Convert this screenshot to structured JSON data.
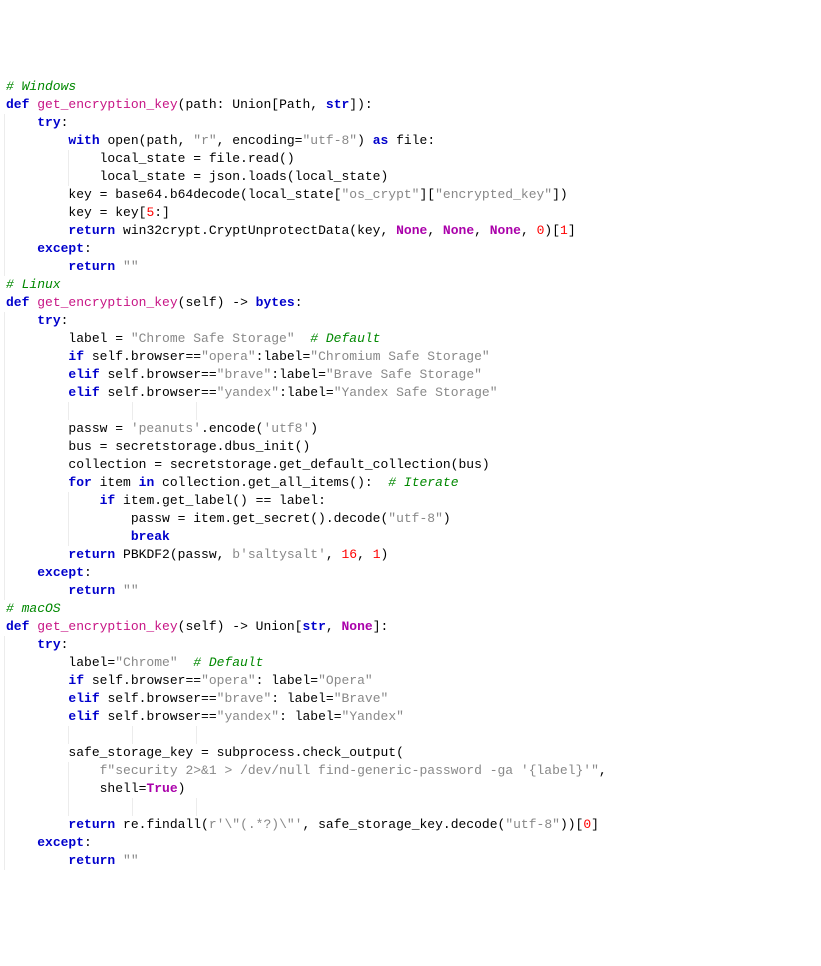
{
  "indentGuideColumns": [
    1,
    9,
    17,
    25
  ],
  "indentUnit": 4,
  "colors": {
    "keyword": "#0000cc",
    "funcName": "#c71585",
    "string": "#888888",
    "number": "#ff0000",
    "comment": "#008800",
    "constant": "#aa00aa",
    "guide": "#ececec"
  },
  "lines": [
    [
      [
        "cmt",
        "# Windows"
      ]
    ],
    [
      [
        "kw",
        "def"
      ],
      [
        "id",
        " "
      ],
      [
        "fn",
        "get_encryption_key"
      ],
      [
        "id",
        "(path: Union[Path, "
      ],
      [
        "kw",
        "str"
      ],
      [
        "id",
        "]):"
      ]
    ],
    [
      [
        "id",
        "    "
      ],
      [
        "kw",
        "try"
      ],
      [
        "id",
        ":"
      ]
    ],
    [
      [
        "id",
        "        "
      ],
      [
        "kw",
        "with"
      ],
      [
        "id",
        " open(path, "
      ],
      [
        "str",
        "\"r\""
      ],
      [
        "id",
        ", encoding="
      ],
      [
        "str",
        "\"utf-8\""
      ],
      [
        "id",
        ") "
      ],
      [
        "kw",
        "as"
      ],
      [
        "id",
        " file:"
      ]
    ],
    [
      [
        "id",
        "            local_state = file.read()"
      ]
    ],
    [
      [
        "id",
        "            local_state = json.loads(local_state)"
      ]
    ],
    [
      [
        "id",
        "        key = base64.b64decode(local_state["
      ],
      [
        "str",
        "\"os_crypt\""
      ],
      [
        "id",
        "]["
      ],
      [
        "str",
        "\"encrypted_key\""
      ],
      [
        "id",
        "])"
      ]
    ],
    [
      [
        "id",
        "        key = key["
      ],
      [
        "num",
        "5"
      ],
      [
        "id",
        ":]"
      ]
    ],
    [
      [
        "id",
        "        "
      ],
      [
        "kw",
        "return"
      ],
      [
        "id",
        " win32crypt.CryptUnprotectData(key, "
      ],
      [
        "const",
        "None"
      ],
      [
        "id",
        ", "
      ],
      [
        "const",
        "None"
      ],
      [
        "id",
        ", "
      ],
      [
        "const",
        "None"
      ],
      [
        "id",
        ", "
      ],
      [
        "num",
        "0"
      ],
      [
        "id",
        ")["
      ],
      [
        "num",
        "1"
      ],
      [
        "id",
        "]"
      ]
    ],
    [
      [
        "id",
        "    "
      ],
      [
        "kw",
        "except"
      ],
      [
        "id",
        ":"
      ]
    ],
    [
      [
        "id",
        "        "
      ],
      [
        "kw",
        "return"
      ],
      [
        "id",
        " "
      ],
      [
        "str",
        "\"\""
      ]
    ],
    [
      [
        "cmt",
        "# Linux"
      ]
    ],
    [
      [
        "kw",
        "def"
      ],
      [
        "id",
        " "
      ],
      [
        "fn",
        "get_encryption_key"
      ],
      [
        "id",
        "(self) -> "
      ],
      [
        "kw",
        "bytes"
      ],
      [
        "id",
        ":"
      ]
    ],
    [
      [
        "id",
        "    "
      ],
      [
        "kw",
        "try"
      ],
      [
        "id",
        ":"
      ]
    ],
    [
      [
        "id",
        "        label = "
      ],
      [
        "str",
        "\"Chrome Safe Storage\""
      ],
      [
        "id",
        "  "
      ],
      [
        "cmt",
        "# Default"
      ]
    ],
    [
      [
        "id",
        "        "
      ],
      [
        "kw",
        "if"
      ],
      [
        "id",
        " self.browser=="
      ],
      [
        "str",
        "\"opera\""
      ],
      [
        "id",
        ":label="
      ],
      [
        "str",
        "\"Chromium Safe Storage\""
      ]
    ],
    [
      [
        "id",
        "        "
      ],
      [
        "kw",
        "elif"
      ],
      [
        "id",
        " self.browser=="
      ],
      [
        "str",
        "\"brave\""
      ],
      [
        "id",
        ":label="
      ],
      [
        "str",
        "\"Brave Safe Storage\""
      ]
    ],
    [
      [
        "id",
        "        "
      ],
      [
        "kw",
        "elif"
      ],
      [
        "id",
        " self.browser=="
      ],
      [
        "str",
        "\"yandex\""
      ],
      [
        "id",
        ":label="
      ],
      [
        "str",
        "\"Yandex Safe Storage\""
      ]
    ],
    [],
    [
      [
        "id",
        "        passw = "
      ],
      [
        "str",
        "'peanuts'"
      ],
      [
        "id",
        ".encode("
      ],
      [
        "str",
        "'utf8'"
      ],
      [
        "id",
        ")"
      ]
    ],
    [
      [
        "id",
        "        bus = secretstorage.dbus_init()"
      ]
    ],
    [
      [
        "id",
        "        collection = secretstorage.get_default_collection(bus)"
      ]
    ],
    [
      [
        "id",
        "        "
      ],
      [
        "kw",
        "for"
      ],
      [
        "id",
        " item "
      ],
      [
        "kw",
        "in"
      ],
      [
        "id",
        " collection.get_all_items():  "
      ],
      [
        "cmt",
        "# Iterate"
      ]
    ],
    [
      [
        "id",
        "            "
      ],
      [
        "kw",
        "if"
      ],
      [
        "id",
        " item.get_label() == label:"
      ]
    ],
    [
      [
        "id",
        "                passw = item.get_secret().decode("
      ],
      [
        "str",
        "\"utf-8\""
      ],
      [
        "id",
        ")"
      ]
    ],
    [
      [
        "id",
        "                "
      ],
      [
        "kw",
        "break"
      ]
    ],
    [
      [
        "id",
        "        "
      ],
      [
        "kw",
        "return"
      ],
      [
        "id",
        " PBKDF2(passw, "
      ],
      [
        "str",
        "b'saltysalt'"
      ],
      [
        "id",
        ", "
      ],
      [
        "num",
        "16"
      ],
      [
        "id",
        ", "
      ],
      [
        "num",
        "1"
      ],
      [
        "id",
        ")"
      ]
    ],
    [
      [
        "id",
        "    "
      ],
      [
        "kw",
        "except"
      ],
      [
        "id",
        ":"
      ]
    ],
    [
      [
        "id",
        "        "
      ],
      [
        "kw",
        "return"
      ],
      [
        "id",
        " "
      ],
      [
        "str",
        "\"\""
      ]
    ],
    [
      [
        "cmt",
        "# macOS"
      ]
    ],
    [
      [
        "kw",
        "def"
      ],
      [
        "id",
        " "
      ],
      [
        "fn",
        "get_encryption_key"
      ],
      [
        "id",
        "(self) -> Union["
      ],
      [
        "kw",
        "str"
      ],
      [
        "id",
        ", "
      ],
      [
        "const",
        "None"
      ],
      [
        "id",
        "]:"
      ]
    ],
    [
      [
        "id",
        "    "
      ],
      [
        "kw",
        "try"
      ],
      [
        "id",
        ":"
      ]
    ],
    [
      [
        "id",
        "        label="
      ],
      [
        "str",
        "\"Chrome\""
      ],
      [
        "id",
        "  "
      ],
      [
        "cmt",
        "# Default"
      ]
    ],
    [
      [
        "id",
        "        "
      ],
      [
        "kw",
        "if"
      ],
      [
        "id",
        " self.browser=="
      ],
      [
        "str",
        "\"opera\""
      ],
      [
        "id",
        ": label="
      ],
      [
        "str",
        "\"Opera\""
      ]
    ],
    [
      [
        "id",
        "        "
      ],
      [
        "kw",
        "elif"
      ],
      [
        "id",
        " self.browser=="
      ],
      [
        "str",
        "\"brave\""
      ],
      [
        "id",
        ": label="
      ],
      [
        "str",
        "\"Brave\""
      ]
    ],
    [
      [
        "id",
        "        "
      ],
      [
        "kw",
        "elif"
      ],
      [
        "id",
        " self.browser=="
      ],
      [
        "str",
        "\"yandex\""
      ],
      [
        "id",
        ": label="
      ],
      [
        "str",
        "\"Yandex\""
      ]
    ],
    [],
    [
      [
        "id",
        "        safe_storage_key = subprocess.check_output("
      ]
    ],
    [
      [
        "id",
        "            "
      ],
      [
        "str",
        "f\"security 2>&1 > /dev/null find-generic-password -ga '{label}'\""
      ],
      [
        "id",
        ","
      ]
    ],
    [
      [
        "id",
        "            shell="
      ],
      [
        "const",
        "True"
      ],
      [
        "id",
        ")"
      ]
    ],
    [],
    [
      [
        "id",
        "        "
      ],
      [
        "kw",
        "return"
      ],
      [
        "id",
        " re.findall("
      ],
      [
        "str",
        "r'\\\"(.*?)\\\"'"
      ],
      [
        "id",
        ", safe_storage_key.decode("
      ],
      [
        "str",
        "\"utf-8\""
      ],
      [
        "id",
        "))["
      ],
      [
        "num",
        "0"
      ],
      [
        "id",
        "]"
      ]
    ],
    [
      [
        "id",
        "    "
      ],
      [
        "kw",
        "except"
      ],
      [
        "id",
        ":"
      ]
    ],
    [
      [
        "id",
        "        "
      ],
      [
        "kw",
        "return"
      ],
      [
        "id",
        " "
      ],
      [
        "str",
        "\"\""
      ]
    ]
  ]
}
